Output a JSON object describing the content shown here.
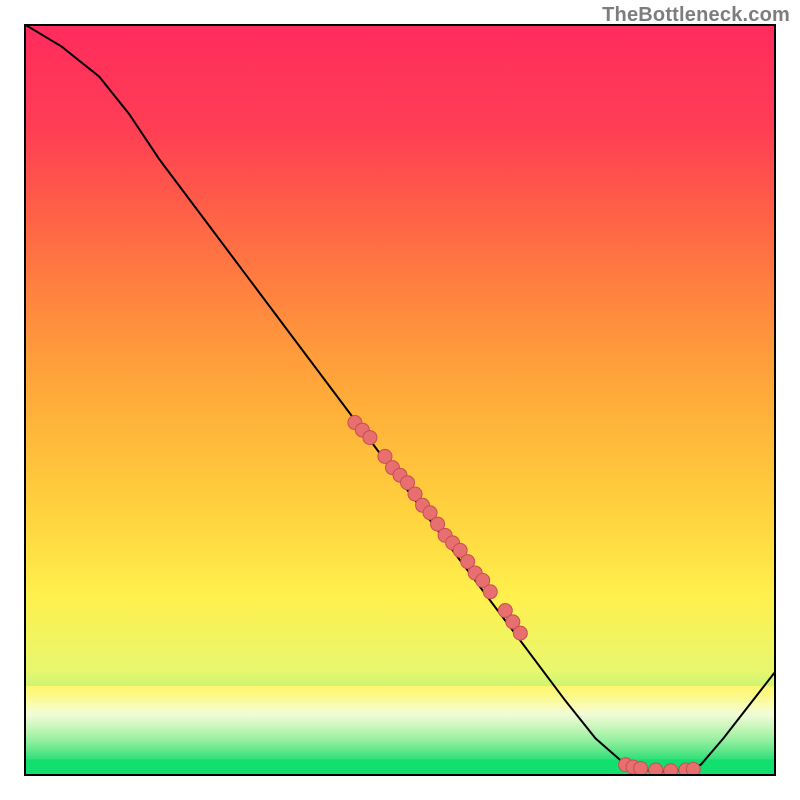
{
  "watermark": "TheBottleneck.com",
  "colors": {
    "curve_stroke": "#000000",
    "dot_fill": "#e76f6f",
    "dot_stroke": "#c94f4f",
    "frame": "#000000"
  },
  "chart_data": {
    "type": "line",
    "title": "",
    "xlabel": "",
    "ylabel": "",
    "xlim": [
      0,
      100
    ],
    "ylim": [
      0,
      100
    ],
    "curve": [
      {
        "x": 0,
        "y": 100
      },
      {
        "x": 5,
        "y": 97
      },
      {
        "x": 10,
        "y": 93
      },
      {
        "x": 14,
        "y": 88
      },
      {
        "x": 18,
        "y": 82
      },
      {
        "x": 24,
        "y": 74
      },
      {
        "x": 30,
        "y": 66
      },
      {
        "x": 36,
        "y": 58
      },
      {
        "x": 42,
        "y": 50
      },
      {
        "x": 48,
        "y": 42
      },
      {
        "x": 54,
        "y": 34
      },
      {
        "x": 60,
        "y": 26
      },
      {
        "x": 66,
        "y": 18
      },
      {
        "x": 72,
        "y": 10
      },
      {
        "x": 76,
        "y": 5
      },
      {
        "x": 80,
        "y": 1.5
      },
      {
        "x": 82,
        "y": 0.8
      },
      {
        "x": 85,
        "y": 0.6
      },
      {
        "x": 88,
        "y": 0.8
      },
      {
        "x": 90,
        "y": 1.5
      },
      {
        "x": 93,
        "y": 5
      },
      {
        "x": 100,
        "y": 14
      }
    ],
    "dots": [
      {
        "x": 44,
        "y": 47
      },
      {
        "x": 45,
        "y": 46
      },
      {
        "x": 46,
        "y": 45
      },
      {
        "x": 48,
        "y": 42.5
      },
      {
        "x": 49,
        "y": 41
      },
      {
        "x": 50,
        "y": 40
      },
      {
        "x": 51,
        "y": 39
      },
      {
        "x": 52,
        "y": 37.5
      },
      {
        "x": 53,
        "y": 36
      },
      {
        "x": 54,
        "y": 35
      },
      {
        "x": 55,
        "y": 33.5
      },
      {
        "x": 56,
        "y": 32
      },
      {
        "x": 57,
        "y": 31
      },
      {
        "x": 58,
        "y": 30
      },
      {
        "x": 59,
        "y": 28.5
      },
      {
        "x": 60,
        "y": 27
      },
      {
        "x": 61,
        "y": 26
      },
      {
        "x": 62,
        "y": 24.5
      },
      {
        "x": 64,
        "y": 22
      },
      {
        "x": 65,
        "y": 20.5
      },
      {
        "x": 66,
        "y": 19
      },
      {
        "x": 80,
        "y": 1.5
      },
      {
        "x": 81,
        "y": 1.2
      },
      {
        "x": 82,
        "y": 1.0
      },
      {
        "x": 84,
        "y": 0.8
      },
      {
        "x": 86,
        "y": 0.7
      },
      {
        "x": 88,
        "y": 0.8
      },
      {
        "x": 89,
        "y": 0.9
      }
    ]
  }
}
